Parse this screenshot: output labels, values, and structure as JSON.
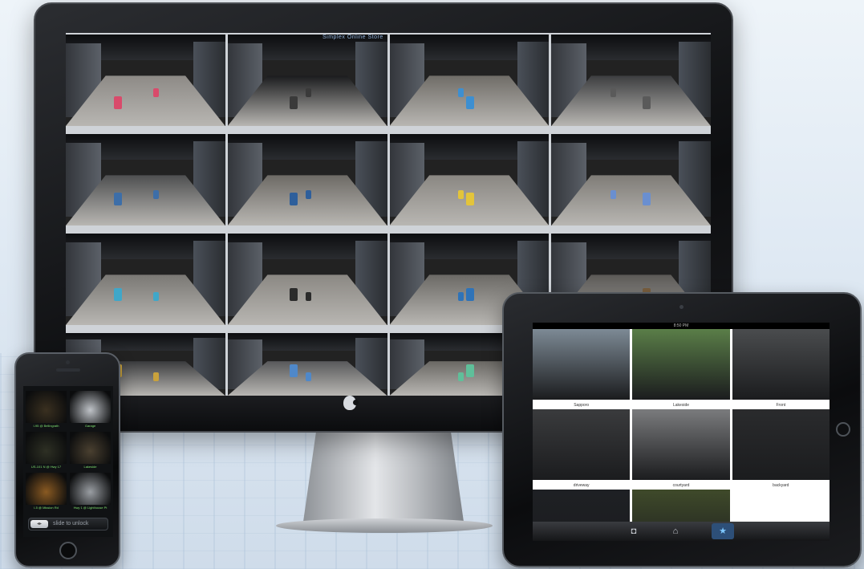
{
  "imac": {
    "screen_title": "Simplex Online Store",
    "rows": [
      [
        {
          "tone": "#8d8a86",
          "obj": "#d94b6b"
        },
        {
          "tone": "#1a1b1d",
          "obj": "#3a3a3a"
        },
        {
          "tone": "#6f6c67",
          "obj": "#3d8fd1"
        },
        {
          "tone": "#3c3d3f",
          "obj": "#5a5a5a"
        }
      ],
      [
        {
          "tone": "#4e4f50",
          "obj": "#3d6ea8"
        },
        {
          "tone": "#6d6a65",
          "obj": "#2e5f9b"
        },
        {
          "tone": "#8a8782",
          "obj": "#e3c43a"
        },
        {
          "tone": "#7f7c77",
          "obj": "#6a8fd0"
        }
      ],
      [
        {
          "tone": "#7a7874",
          "obj": "#3fa7c9"
        },
        {
          "tone": "#8b8883",
          "obj": "#2b2b2b"
        },
        {
          "tone": "#6b6965",
          "obj": "#2f73b8"
        },
        {
          "tone": "#5a5855",
          "obj": "#7a5f3f"
        }
      ],
      [
        {
          "tone": "#3a3b3d",
          "obj": "#c9a23c"
        },
        {
          "tone": "#58595b",
          "obj": "#4f88c9"
        },
        {
          "tone": "#6a6864",
          "obj": "#5fbf9a"
        },
        {
          "tone": "#4a4b4d",
          "obj": "#e0d04a"
        }
      ]
    ]
  },
  "ipad": {
    "status": "8:50 PM",
    "cameras": [
      {
        "caption": "Sapporo",
        "tone": "#7d8a95"
      },
      {
        "caption": "Lakeside",
        "tone": "#5a7e48"
      },
      {
        "caption": "Front",
        "tone": "#4a4c4e"
      },
      {
        "caption": "driveway",
        "tone": "#3a3b3d"
      },
      {
        "caption": "courtyard",
        "tone": "#7a7b7d"
      },
      {
        "caption": "backyard",
        "tone": "#2a2b2d"
      },
      {
        "caption": "",
        "tone": "#1e2024"
      },
      {
        "caption": "",
        "tone": "#3f4a2a"
      },
      {
        "caption": "",
        "tone": "#ffffff"
      }
    ],
    "tabs": [
      {
        "icon": "camera-icon",
        "glyph": "◘"
      },
      {
        "icon": "home-icon",
        "glyph": "⌂"
      },
      {
        "icon": "star-icon",
        "glyph": "★"
      }
    ]
  },
  "iphone": {
    "slider_knob": "◂▸",
    "slider_text": "slide to unlock",
    "cameras": [
      {
        "caption": "I-95 @ Bellingrath",
        "tone": "#3a3020"
      },
      {
        "caption": "Garage",
        "tone": "#bfc3c8"
      },
      {
        "caption": "US-101 N @ Hwy 17",
        "tone": "#2e3024"
      },
      {
        "caption": "Lakeside",
        "tone": "#4a4030"
      },
      {
        "caption": "I-5 @ Mission Rd",
        "tone": "#8a5a22"
      },
      {
        "caption": "Hwy 1 @ Lighthouse Pt",
        "tone": "#9a9ea3"
      }
    ]
  }
}
